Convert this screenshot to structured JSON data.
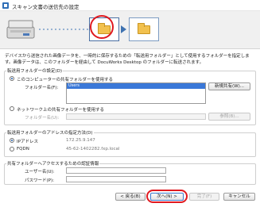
{
  "window": {
    "title": "スキャン文書の送信先の設定"
  },
  "banner": {
    "icons": [
      "scanner-icon",
      "folder-icon",
      "folder-icon"
    ]
  },
  "description": "デバイスから送信された画像データを、一時的に保存するための「転送用フォルダー」として使用するフォルダーを指定します。画像データは、このフォルダーを経由して DocuWorks Desktop のフォルダーに転送されます。",
  "transfer_folder": {
    "group_title": "転送用フォルダーの設定(D)",
    "local_option_label": "このコンピューターの共有フォルダーを使用する",
    "folder_name_label": "フォルダー名(F):",
    "folder_list": [
      "Users"
    ],
    "new_share_button": "新規共有(W)...",
    "network_option_label": "ネットワーク上の共有フォルダーを使用する",
    "network_folder_label": "フォルダー名(U):",
    "browse_button": "参照(B)..."
  },
  "address": {
    "group_title": "転送用フォルダーのアドレスの指定方法(D)",
    "ip_label": "IPアドレス",
    "ip_value": "172.25.9.147",
    "fqdn_label": "FQDN",
    "fqdn_value": "45-62-1402282.fxp.local"
  },
  "auth": {
    "group_title": "共有フォルダーへアクセスするための認証情報",
    "username_label": "ユーザー名(U):",
    "password_label": "パスワード(P):"
  },
  "footer": {
    "back_button": "< 戻る(B)",
    "next_button": "次へ(N) >",
    "finish_button": "完了(F)",
    "cancel_button": "キャンセル"
  }
}
